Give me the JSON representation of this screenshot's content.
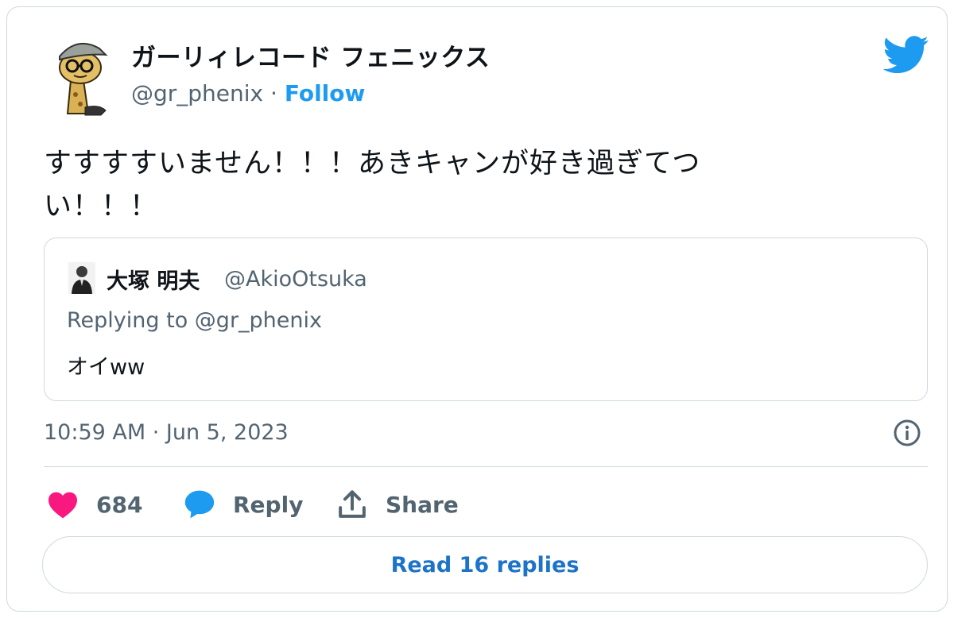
{
  "author": {
    "display_name": "ガーリィレコード フェニックス",
    "handle": "@gr_phenix",
    "separator": " · ",
    "follow_label": "Follow",
    "avatar_icon": "giraffe-cartoon-avatar"
  },
  "tweet": {
    "text_line1": "すすすすいません！！！あきキャンが好き過ぎてつ",
    "text_line2": "い！！！"
  },
  "quoted_tweet": {
    "display_name": "大塚 明夫",
    "handle": "@AkioOtsuka",
    "replying_to": "Replying to @gr_phenix",
    "text": "オイww",
    "avatar_icon": "person-photo-avatar"
  },
  "timestamp": "10:59 AM · Jun 5, 2023",
  "actions": {
    "like_count": "684",
    "reply_label": "Reply",
    "share_label": "Share"
  },
  "read_replies_label": "Read 16 replies",
  "colors": {
    "accent": "#1d9bf0",
    "like": "#f91880",
    "border": "#cfd9de",
    "secondary_text": "#536471",
    "link_button_text": "#1d73c8"
  },
  "icons": {
    "brand": "twitter-bird-icon",
    "info": "info-icon",
    "like": "heart-icon",
    "reply": "speech-bubble-icon",
    "share": "share-arrow-icon"
  }
}
